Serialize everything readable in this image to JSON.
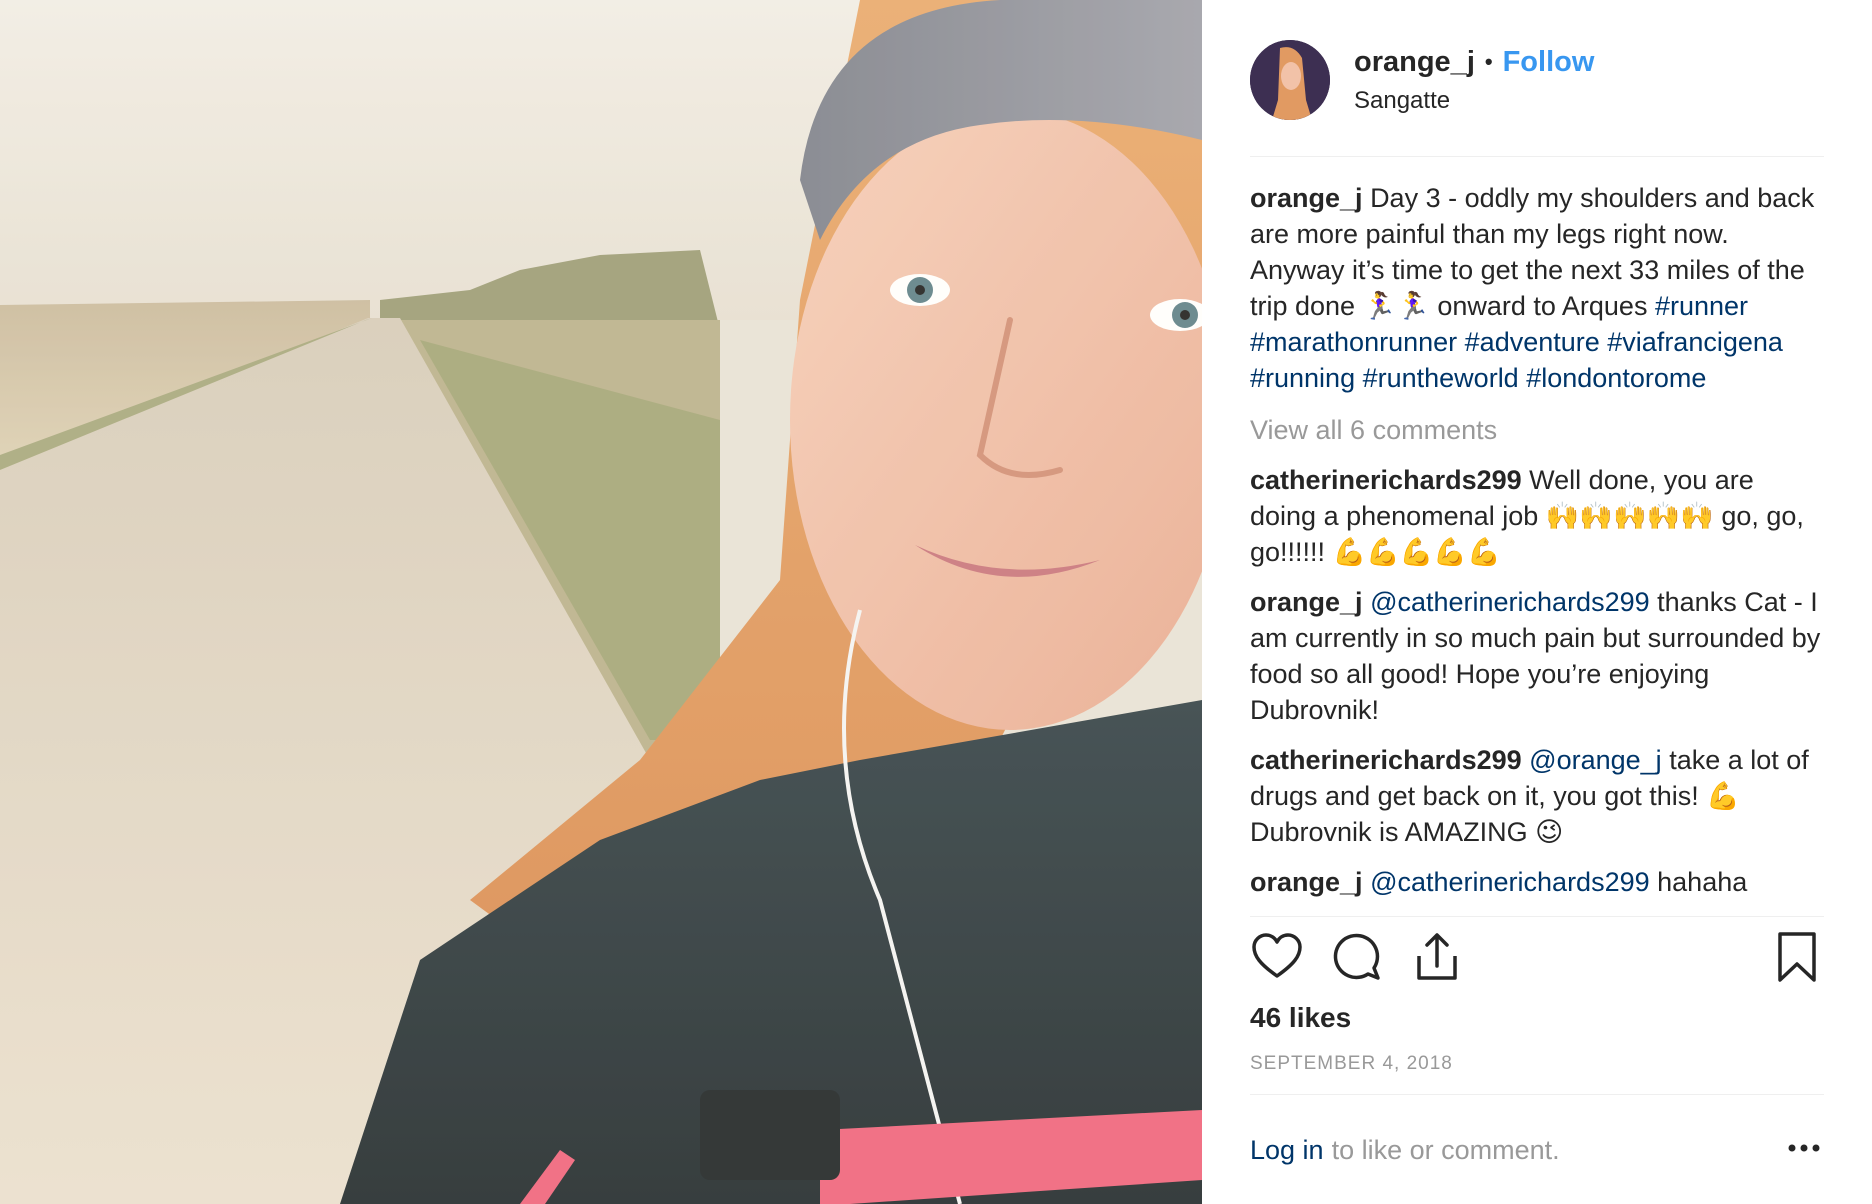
{
  "post": {
    "username": "orange_j",
    "separator": "•",
    "follow_label": "Follow",
    "location": "Sangatte"
  },
  "caption": {
    "username": "orange_j",
    "text_1": "Day 3 - oddly my shoulders and back are more painful than my legs right now. Anyway it’s time to get the next 33 miles of the trip done 🏃‍♀️🏃‍♀️ onward to Arques",
    "hashtags": [
      "#runner",
      "#marathonrunner",
      "#adventure",
      "#viafrancigena",
      "#running",
      "#runtheworld",
      "#londontorome"
    ]
  },
  "view_all_comments": "View all 6 comments",
  "comments": [
    {
      "user": "catherinerichards299",
      "text": "Well done, you are doing a phenomenal job 🙌🙌🙌🙌🙌 go, go, go!!!!!! 💪💪💪💪💪"
    },
    {
      "user": "orange_j",
      "mention": "@catherinerichards299",
      "text": "thanks Cat - I am currently in so much pain but surrounded by food so all good! Hope you’re enjoying Dubrovnik!"
    },
    {
      "user": "catherinerichards299",
      "mention": "@orange_j",
      "text": "take a lot of drugs and get back on it, you got this! 💪 Dubrovnik is AMAZING 😉"
    },
    {
      "user": "orange_j",
      "mention": "@catherinerichards299",
      "text": "hahaha"
    }
  ],
  "actions": {
    "like_icon": "heart-icon",
    "comment_icon": "comment-icon",
    "share_icon": "share-icon",
    "save_icon": "bookmark-icon"
  },
  "likes": "46 likes",
  "date": "SEPTEMBER 4, 2018",
  "footer": {
    "login_link": "Log in",
    "login_suffix": "to like or comment.",
    "more_icon": "more-options-icon"
  },
  "colors": {
    "link_blue": "#3897f0",
    "hashtag_blue": "#003569",
    "muted_gray": "#999999",
    "text_dark": "#262626"
  }
}
